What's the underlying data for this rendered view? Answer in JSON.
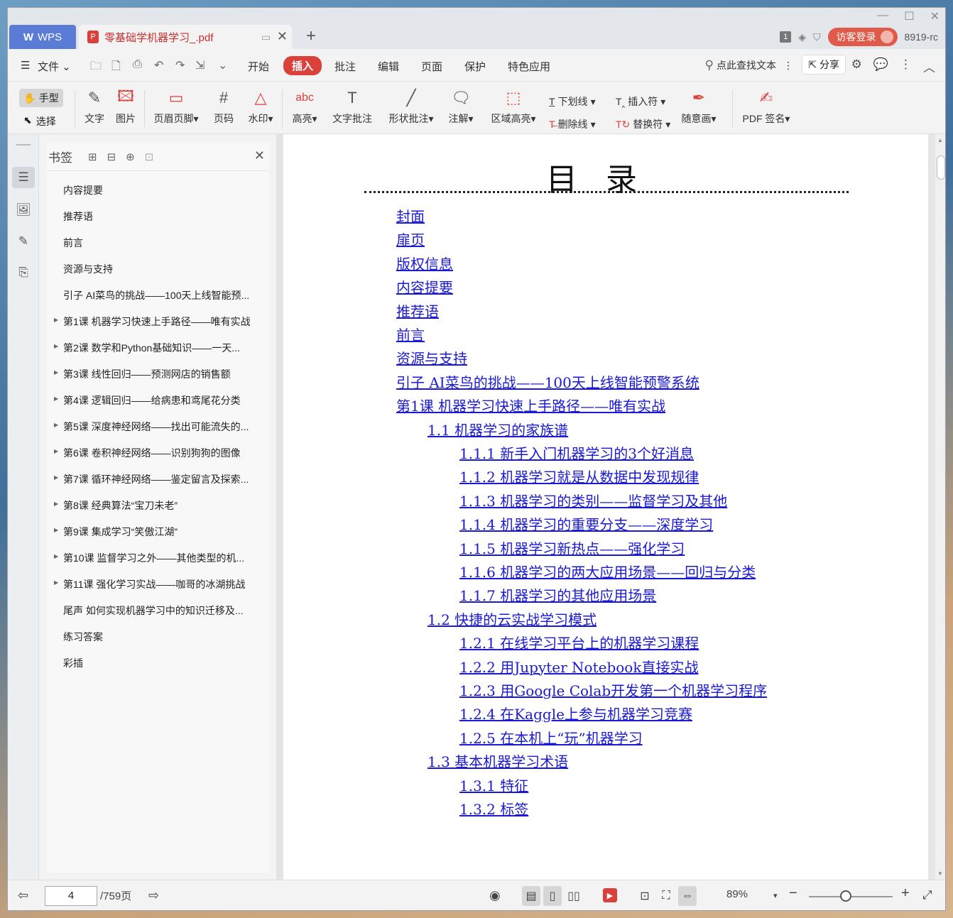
{
  "titlebar": {
    "wps_label": "WPS",
    "doc_tab": "零基础学机器学习_.pdf",
    "login": "访客登录",
    "badge": "1",
    "version": "8919-rc"
  },
  "menubar": {
    "file": "文件",
    "items": [
      "开始",
      "插入",
      "批注",
      "编辑",
      "页面",
      "保护",
      "特色应用"
    ],
    "active": "插入",
    "search": "点此查找文本",
    "share": "分享"
  },
  "ribbon": {
    "hand": "手型",
    "select": "选择",
    "text": "文字",
    "image": "图片",
    "header_footer": "页眉页脚",
    "page_number": "页码",
    "watermark": "水印",
    "highlight": "高亮",
    "text_comment": "文字批注",
    "shape_comment": "形状批注",
    "note": "注解",
    "area_highlight": "区域高亮",
    "underline": "下划线",
    "strikethrough": "删除线",
    "insert_mark": "插入符",
    "replace_mark": "替换符",
    "freehand": "随意画",
    "pdf_sign": "PDF 签名"
  },
  "bookmarks": {
    "title": "书签",
    "items": [
      {
        "label": "内容提要",
        "expandable": false
      },
      {
        "label": "推荐语",
        "expandable": false
      },
      {
        "label": "前言",
        "expandable": false
      },
      {
        "label": "资源与支持",
        "expandable": false
      },
      {
        "label": "引子 AI菜鸟的挑战——100天上线智能预...",
        "expandable": false
      },
      {
        "label": "第1课 机器学习快速上手路径——唯有实战",
        "expandable": true
      },
      {
        "label": "第2课 数学和Python基础知识——一天...",
        "expandable": true
      },
      {
        "label": "第3课 线性回归——预测网店的销售额",
        "expandable": true
      },
      {
        "label": "第4课 逻辑回归——给病患和鸢尾花分类",
        "expandable": true
      },
      {
        "label": "第5课 深度神经网络——找出可能流失的...",
        "expandable": true
      },
      {
        "label": "第6课 卷积神经网络——识别狗狗的图像",
        "expandable": true
      },
      {
        "label": "第7课 循环神经网络——鉴定留言及探索...",
        "expandable": true
      },
      {
        "label": "第8课 经典算法“宝刀未老”",
        "expandable": true
      },
      {
        "label": "第9课 集成学习“笑傲江湖”",
        "expandable": true
      },
      {
        "label": "第10课 监督学习之外——其他类型的机...",
        "expandable": true
      },
      {
        "label": "第11课 强化学习实战——咖哥的冰湖挑战",
        "expandable": true
      },
      {
        "label": "尾声 如何实现机器学习中的知识迁移及...",
        "expandable": false
      },
      {
        "label": "练习答案",
        "expandable": false
      },
      {
        "label": "彩插",
        "expandable": false
      }
    ]
  },
  "document": {
    "toc_title": "目录",
    "entries": [
      {
        "text": "封面",
        "level": 0
      },
      {
        "text": "扉页",
        "level": 0
      },
      {
        "text": "版权信息",
        "level": 0
      },
      {
        "text": "内容提要",
        "level": 0
      },
      {
        "text": "推荐语",
        "level": 0
      },
      {
        "text": "前言",
        "level": 0
      },
      {
        "text": "资源与支持",
        "level": 0
      },
      {
        "text": "引子 AI菜鸟的挑战——100天上线智能预警系统",
        "level": 0
      },
      {
        "text": "第1课 机器学习快速上手路径——唯有实战",
        "level": 0
      },
      {
        "text": "1.1 机器学习的家族谱",
        "level": 1
      },
      {
        "text": "1.1.1 新手入门机器学习的3个好消息",
        "level": 2
      },
      {
        "text": "1.1.2 机器学习就是从数据中发现规律",
        "level": 2
      },
      {
        "text": "1.1.3 机器学习的类别——监督学习及其他",
        "level": 2
      },
      {
        "text": "1.1.4 机器学习的重要分支——深度学习",
        "level": 2
      },
      {
        "text": "1.1.5 机器学习新热点——强化学习",
        "level": 2
      },
      {
        "text": "1.1.6 机器学习的两大应用场景——回归与分类",
        "level": 2
      },
      {
        "text": "1.1.7 机器学习的其他应用场景",
        "level": 2
      },
      {
        "text": "1.2 快捷的云实战学习模式",
        "level": 1
      },
      {
        "text": "1.2.1 在线学习平台上的机器学习课程",
        "level": 2
      },
      {
        "text": "1.2.2 用Jupyter Notebook直接实战",
        "level": 2
      },
      {
        "text": "1.2.3 用Google Colab开发第一个机器学习程序",
        "level": 2
      },
      {
        "text": "1.2.4 在Kaggle上参与机器学习竞赛",
        "level": 2
      },
      {
        "text": "1.2.5 在本机上“玩”机器学习",
        "level": 2
      },
      {
        "text": "1.3 基本机器学习术语",
        "level": 1
      },
      {
        "text": "1.3.1 特征",
        "level": 2
      },
      {
        "text": "1.3.2 标签",
        "level": 2
      }
    ]
  },
  "statusbar": {
    "current_page": "4",
    "total_pages": "/759页",
    "zoom": "89%"
  },
  "colors": {
    "accent": "#d9413a",
    "link": "#1a1ad6",
    "wps_tab": "#5a7bd6"
  }
}
